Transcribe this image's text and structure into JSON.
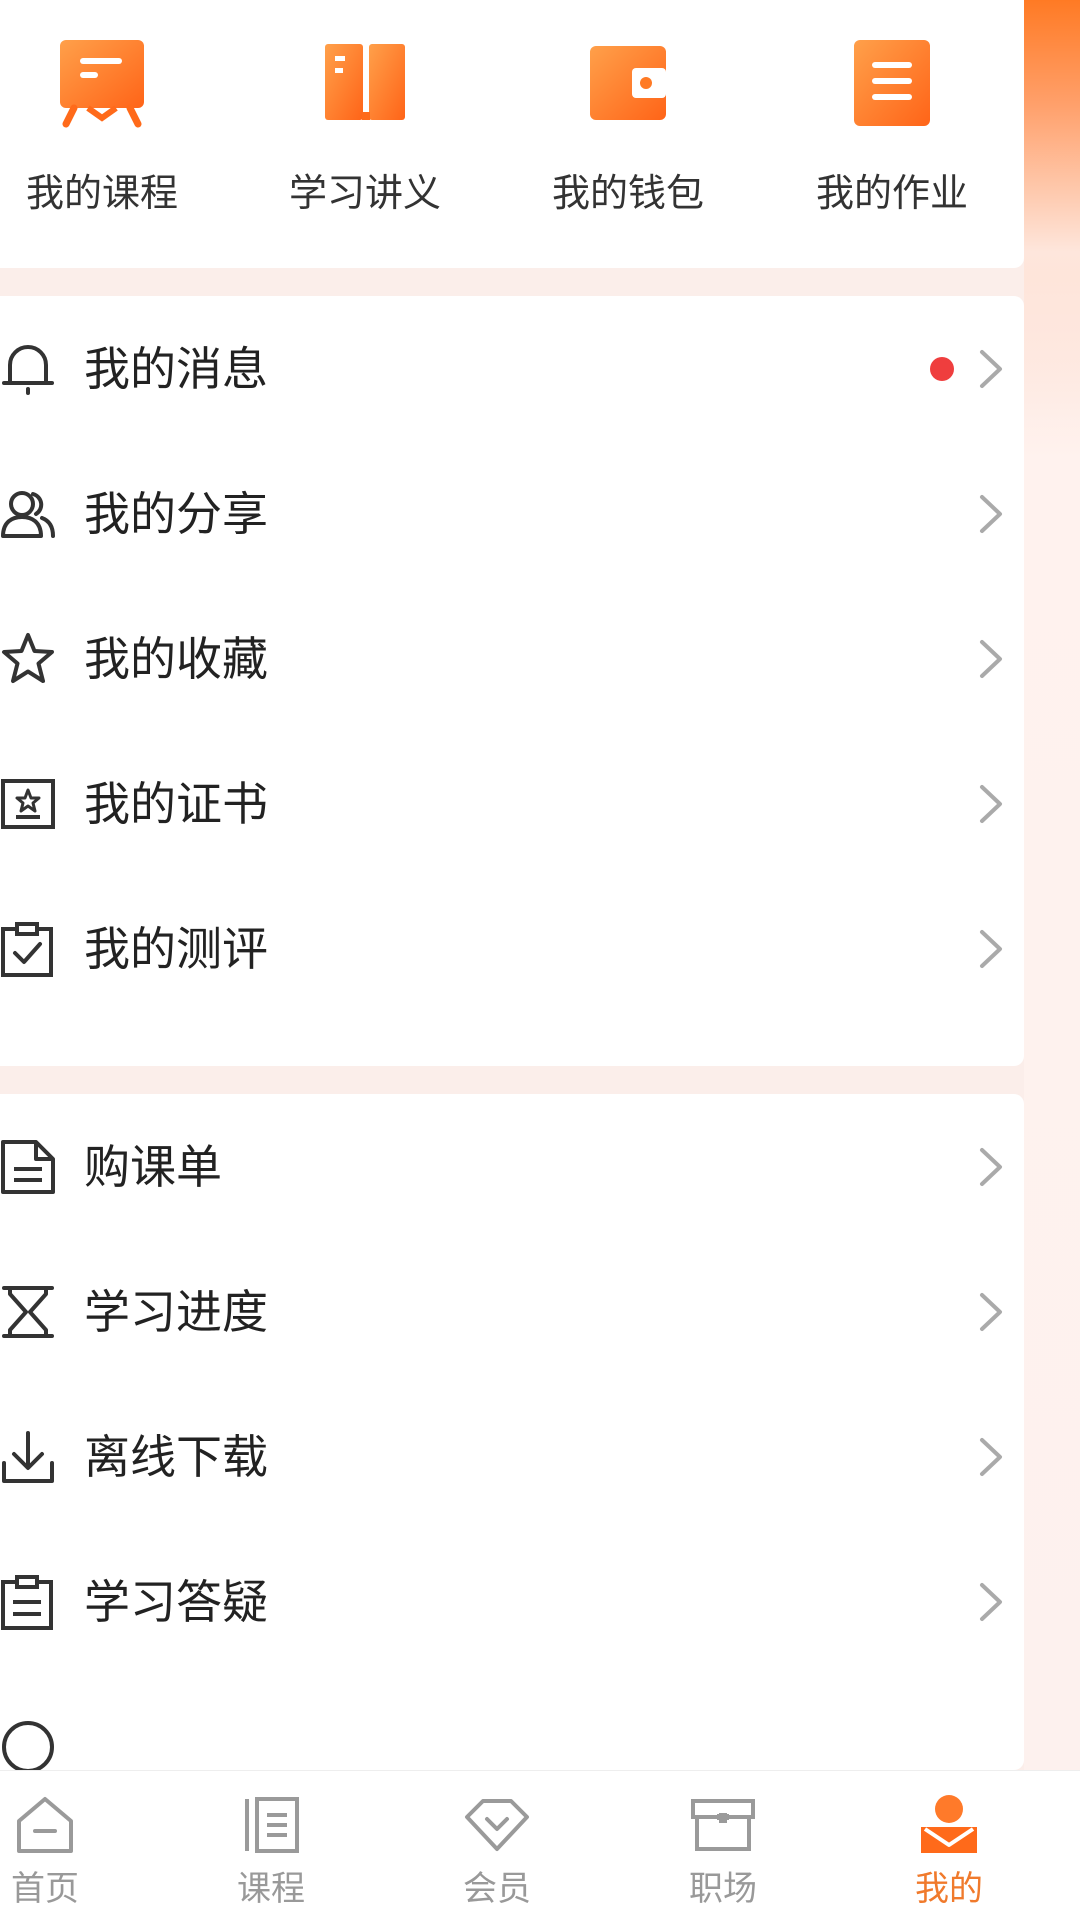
{
  "colors": {
    "accent": "#f07a2c",
    "icon_orange_light": "#ff9a3c",
    "icon_orange_dark": "#ff6a1a",
    "badge_red": "#ef3e3e",
    "text_dark": "#222222",
    "tab_inactive": "#999999"
  },
  "quick_actions": [
    {
      "label": "我的课程",
      "icon": "course-board-icon"
    },
    {
      "label": "学习讲义",
      "icon": "book-icon"
    },
    {
      "label": "我的钱包",
      "icon": "wallet-icon"
    },
    {
      "label": "我的作业",
      "icon": "homework-list-icon"
    }
  ],
  "menu_group_1": [
    {
      "label": "我的消息",
      "icon": "bell-icon",
      "unread_dot": true
    },
    {
      "label": "我的分享",
      "icon": "users-icon"
    },
    {
      "label": "我的收藏",
      "icon": "star-icon"
    },
    {
      "label": "我的证书",
      "icon": "certificate-icon"
    },
    {
      "label": "我的测评",
      "icon": "clipboard-check-icon"
    }
  ],
  "menu_group_2": [
    {
      "label": "购课单",
      "icon": "document-icon"
    },
    {
      "label": "学习进度",
      "icon": "hourglass-icon"
    },
    {
      "label": "离线下载",
      "icon": "download-icon"
    },
    {
      "label": "学习答疑",
      "icon": "clipboard-list-icon"
    }
  ],
  "tabbar": [
    {
      "label": "首页",
      "icon": "home-icon",
      "active": false
    },
    {
      "label": "课程",
      "icon": "course-list-icon",
      "active": false
    },
    {
      "label": "会员",
      "icon": "member-diamond-icon",
      "active": false
    },
    {
      "label": "职场",
      "icon": "briefcase-icon",
      "active": false
    },
    {
      "label": "我的",
      "icon": "profile-icon",
      "active": true
    }
  ]
}
